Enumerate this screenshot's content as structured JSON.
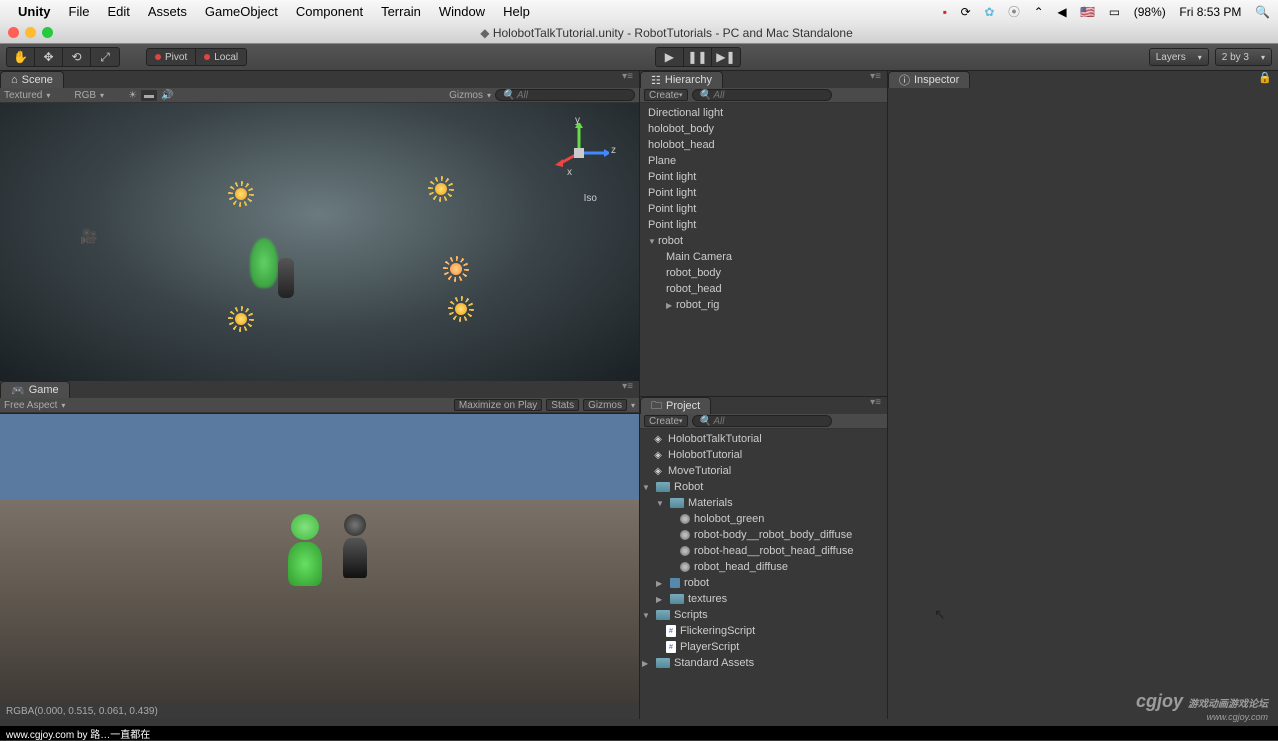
{
  "menubar": {
    "app": "Unity",
    "items": [
      "File",
      "Edit",
      "Assets",
      "GameObject",
      "Component",
      "Terrain",
      "Window",
      "Help"
    ],
    "battery": "(98%)",
    "time": "Fri 8:53 PM"
  },
  "window": {
    "title": "HolobotTalkTutorial.unity - RobotTutorials - PC and Mac Standalone"
  },
  "toolbar": {
    "pivot": "Pivot",
    "local": "Local",
    "layers": "Layers",
    "layout": "2 by 3"
  },
  "scene": {
    "tab": "Scene",
    "textured": "Textured",
    "rgb": "RGB",
    "gizmos": "Gizmos",
    "search_placeholder": "All",
    "iso": "Iso",
    "axes": {
      "x": "x",
      "y": "y",
      "z": "z"
    }
  },
  "game": {
    "tab": "Game",
    "aspect": "Free Aspect",
    "max": "Maximize on Play",
    "stats": "Stats",
    "gizmos": "Gizmos",
    "status": "RGBA(0.000, 0.515, 0.061, 0.439)"
  },
  "hierarchy": {
    "tab": "Hierarchy",
    "create": "Create",
    "search_placeholder": "All",
    "items": [
      "Directional light",
      "holobot_body",
      "holobot_head",
      "Plane",
      "Point light",
      "Point light",
      "Point light",
      "Point light"
    ],
    "robot": "robot",
    "robot_children": [
      "Main Camera",
      "robot_body",
      "robot_head"
    ],
    "robot_rig": "robot_rig"
  },
  "project": {
    "tab": "Project",
    "create": "Create",
    "search_placeholder": "All",
    "scenes": [
      "HolobotTalkTutorial",
      "HolobotTutorial",
      "MoveTutorial"
    ],
    "robot": "Robot",
    "materials": "Materials",
    "mats": [
      "holobot_green",
      "robot-body__robot_body_diffuse",
      "robot-head__robot_head_diffuse",
      "robot_head_diffuse"
    ],
    "robot_sub": "robot",
    "textures": "textures",
    "scripts": "Scripts",
    "script_items": [
      "FlickeringScript",
      "PlayerScript"
    ],
    "std": "Standard Assets"
  },
  "inspector": {
    "tab": "Inspector"
  },
  "watermark": {
    "main": "cgjoy",
    "sub": "www.cgjoy.com"
  },
  "footer": "www.cgjoy.com by 路…一直都在"
}
